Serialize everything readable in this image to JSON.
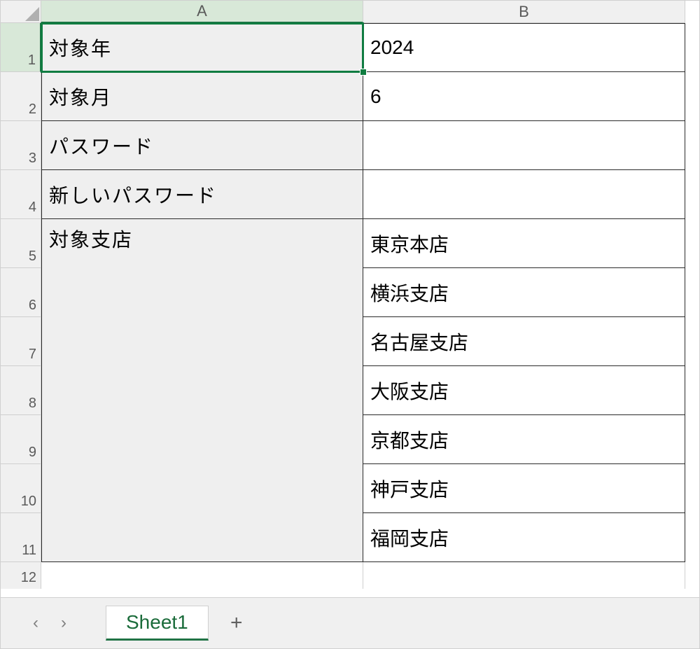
{
  "columns": {
    "A": "A",
    "B": "B"
  },
  "row_numbers": [
    "1",
    "2",
    "3",
    "4",
    "5",
    "6",
    "7",
    "8",
    "9",
    "10",
    "11",
    "12"
  ],
  "cells": {
    "A1": "対象年",
    "B1": "2024",
    "A2": "対象月",
    "B2": "6",
    "A3": "パスワード",
    "B3": "",
    "A4": "新しいパスワード",
    "B4": "",
    "A5": "対象支店",
    "B5": "東京本店",
    "B6": "横浜支店",
    "B7": "名古屋支店",
    "B8": "大阪支店",
    "B9": "京都支店",
    "B10": "神戸支店",
    "B11": "福岡支店"
  },
  "tabs": {
    "active": "Sheet1"
  },
  "icons": {
    "prev": "‹",
    "next": "›",
    "plus": "+"
  },
  "active_cell": "A1"
}
